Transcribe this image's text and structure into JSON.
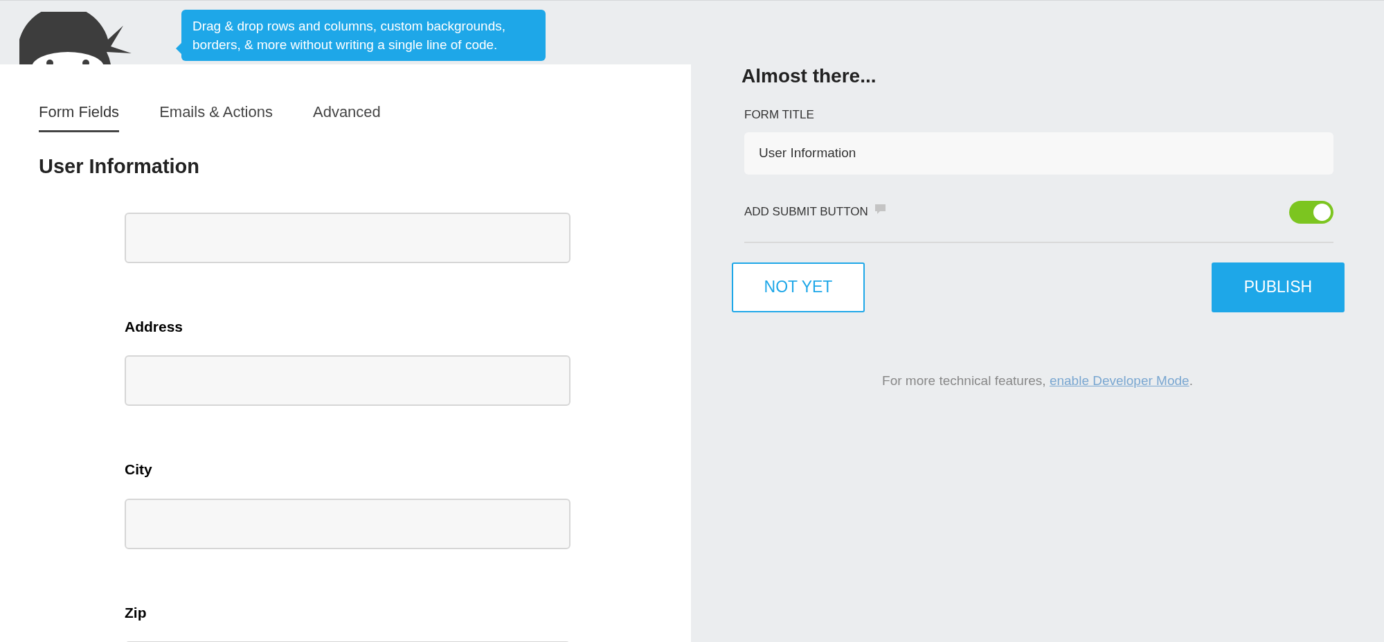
{
  "tooltip": {
    "text": "Drag & drop rows and columns, custom backgrounds, borders, & more without writing a single line of code."
  },
  "tabs": [
    {
      "label": "Form Fields",
      "selected": true
    },
    {
      "label": "Emails & Actions",
      "selected": false
    },
    {
      "label": "Advanced",
      "selected": false
    }
  ],
  "form": {
    "title": "User Information",
    "fields": [
      {
        "kind": "unlabeled"
      },
      {
        "kind": "labeled",
        "label": "Address"
      },
      {
        "kind": "labeled",
        "label": "City"
      },
      {
        "kind": "labeled",
        "label": "Zip"
      }
    ]
  },
  "publish_panel": {
    "heading": "Almost there...",
    "form_title_label": "FORM TITLE",
    "form_title_value": "User Information",
    "submit_label": "ADD SUBMIT BUTTON",
    "submit_on": true,
    "buttons": [
      {
        "label": "NOT YET",
        "kind": "outline"
      },
      {
        "label": "PUBLISH",
        "kind": "primary"
      }
    ],
    "footer_text": "For more technical features, ",
    "footer_link": "enable Developer Mode",
    "footer_end": "."
  }
}
